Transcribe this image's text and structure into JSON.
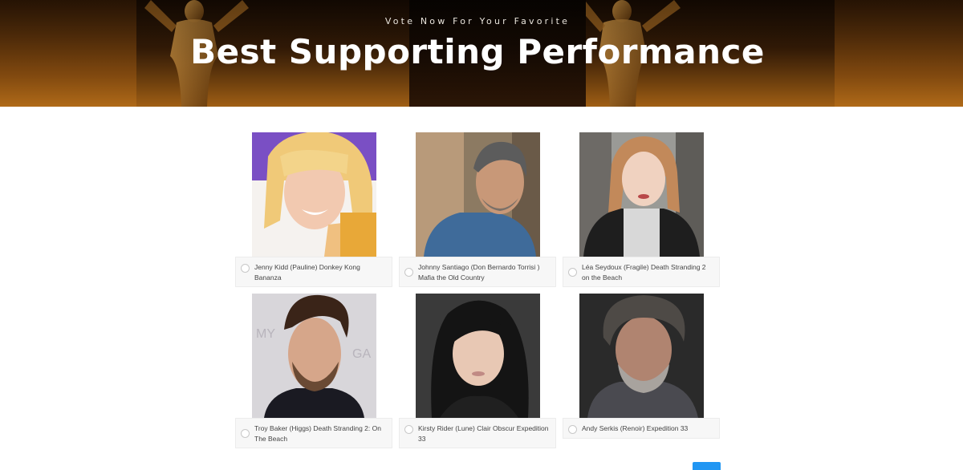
{
  "hero": {
    "subtitle": "Vote Now For Your Favorite",
    "title": "Best Supporting Performance"
  },
  "nominees": [
    {
      "label": "Jenny Kidd (Pauline) Donkey Kong Bananza",
      "photo": "blonde-woman-portrait",
      "bg": "#7a4fc4"
    },
    {
      "label": "Johnny Santiago (Don Bernardo Torrisi ) Mafia the Old Country",
      "photo": "grey-haired-man-portrait",
      "bg": "#8c7a62"
    },
    {
      "label": "Léa Seydoux (Fragile) Death Stranding 2 on the Beach",
      "photo": "redhead-woman-portrait",
      "bg": "#9a9a96"
    },
    {
      "label": "Troy Baker (Higgs) Death Stranding 2: On The Beach",
      "photo": "bearded-man-portrait",
      "bg": "#d8d6da"
    },
    {
      "label": "Kirsty Rider (Lune) Clair Obscur Expedition 33",
      "photo": "dark-haired-woman-portrait",
      "bg": "#3a3a3a"
    },
    {
      "label": "Andy Serkis (Renoir) Expedition 33",
      "photo": "curly-grey-man-portrait",
      "bg": "#2a2a2a"
    }
  ],
  "next_button": {
    "label": ""
  }
}
